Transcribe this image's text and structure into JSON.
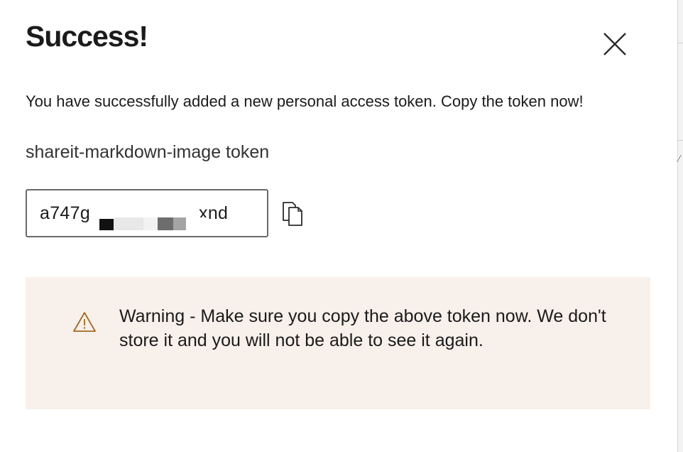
{
  "dialog": {
    "title": "Success!",
    "close_label": "close",
    "description": "You have successfully added a new personal access token. Copy the token now!",
    "token_name": "shareit-markdown-image token",
    "token": {
      "visible_start": "a747g",
      "visible_end": "xnd",
      "redacted": true
    },
    "copy_icon": "copy-icon",
    "warning": {
      "icon": "warning-icon",
      "text": "Warning - Make sure you copy the above token now. We don't store it and you will not be able to see it again."
    }
  },
  "colors": {
    "warning_bg": "#f8f0eb",
    "warning_icon": "#a06a1e",
    "text": "#1b1b1b"
  }
}
